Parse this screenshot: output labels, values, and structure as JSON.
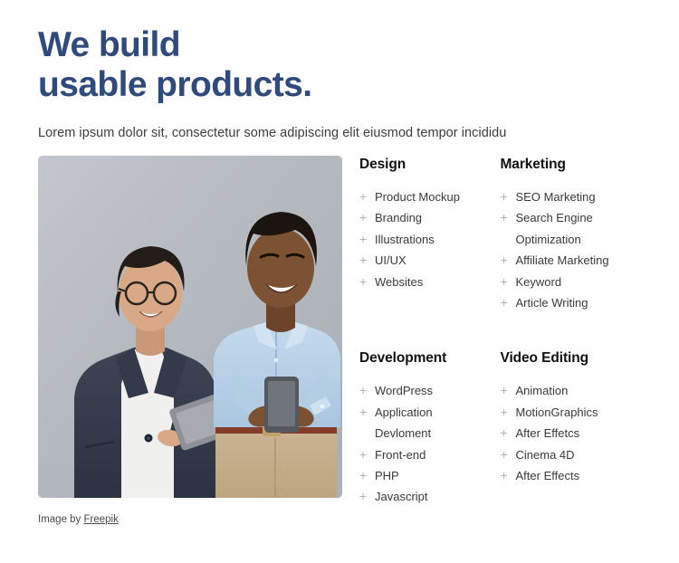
{
  "hero": {
    "title": "We build\nusable products.",
    "subtitle": "Lorem ipsum dolor sit, consectetur some adipiscing elit eiusmod tempor incididu",
    "title_color": "#2f4a7c"
  },
  "photo": {
    "alt": "Two smiling young professionals standing against a grey wall, one holding a tablet and one holding a smartphone",
    "credit_prefix": "Image by ",
    "credit_link": "Freepik"
  },
  "columns": [
    {
      "title": "Design",
      "bullet": "+",
      "items": [
        "Product Mockup",
        "Branding",
        "Illustrations",
        "UI/UX",
        "Websites"
      ]
    },
    {
      "title": "Marketing",
      "bullet": "+",
      "items": [
        "SEO Marketing",
        "Search Engine Optimization",
        "Affiliate Marketing",
        "Keyword",
        "Article Writing"
      ]
    },
    {
      "title": "Development",
      "bullet": "+",
      "items": [
        "WordPress",
        "Application Devloment",
        "Front-end",
        "PHP",
        "Javascript"
      ]
    },
    {
      "title": "Video Editing",
      "bullet": "+",
      "items": [
        "Animation",
        "MotionGraphics",
        "After Effetcs",
        "Cinema 4D",
        "After Effects"
      ]
    }
  ]
}
